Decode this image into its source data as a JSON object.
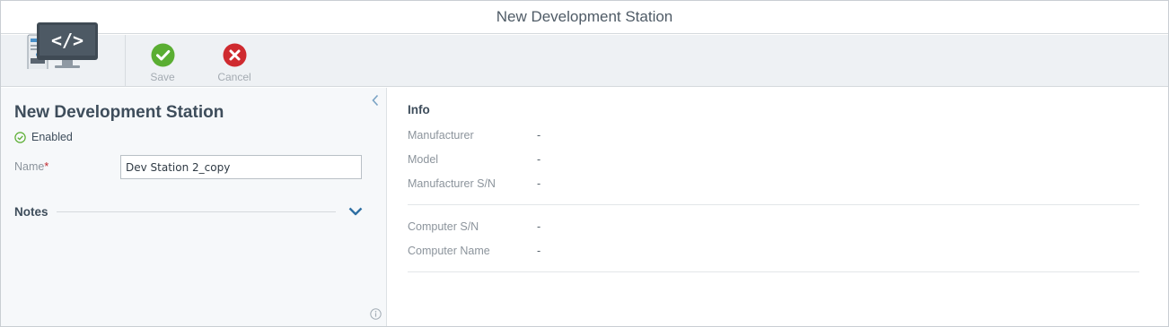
{
  "window": {
    "title": "New Development Station"
  },
  "toolbar": {
    "logo_icon": "dev-station-icon",
    "save": {
      "label": "Save",
      "icon": "check-circle-icon",
      "color": "#5aae32"
    },
    "cancel": {
      "label": "Cancel",
      "icon": "x-circle-icon",
      "color": "#cf2a2f"
    }
  },
  "details": {
    "title": "New Development Station",
    "status": "Enabled",
    "status_color": "#5aae32",
    "name_label": "Name",
    "name_required_marker": "*",
    "name_value": "Dev Station 2_copy",
    "notes_label": "Notes"
  },
  "info": {
    "title": "Info",
    "group1": [
      {
        "label": "Manufacturer",
        "value": "-"
      },
      {
        "label": "Model",
        "value": "-"
      },
      {
        "label": "Manufacturer S/N",
        "value": "-"
      }
    ],
    "group2": [
      {
        "label": "Computer S/N",
        "value": "-"
      },
      {
        "label": "Computer Name",
        "value": "-"
      }
    ]
  },
  "colors": {
    "accent": "#2f6fa3",
    "panel_bg": "#f6f8fa",
    "toolbar_bg": "#eef1f4"
  }
}
